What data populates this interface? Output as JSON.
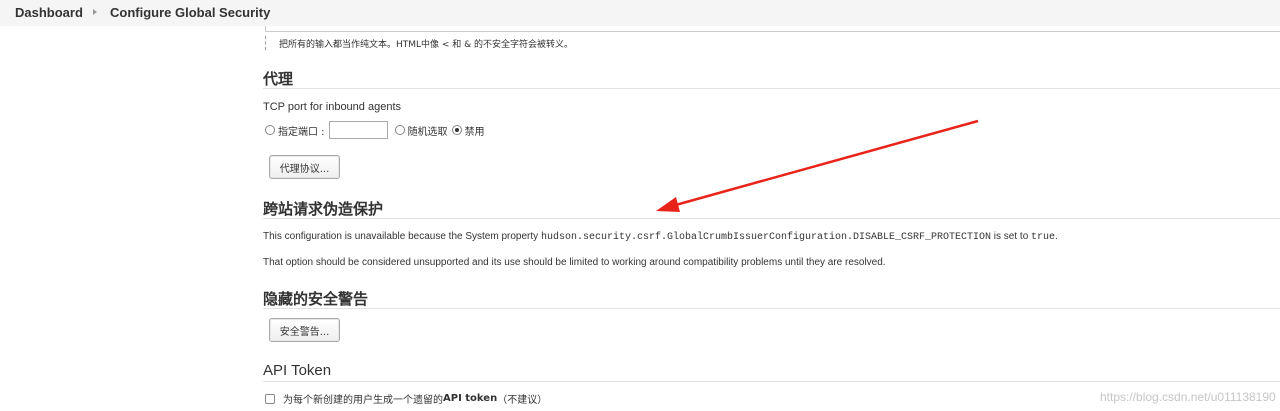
{
  "breadcrumb": {
    "items": [
      "Dashboard",
      "Configure Global Security"
    ]
  },
  "markup_help": "把所有的输入都当作纯文本。HTML中像 < 和 & 的不安全字符会被转义。",
  "proxy": {
    "title": "代理",
    "tcp_label": "TCP port for inbound agents",
    "options": {
      "fixed": "指定端口 :",
      "random": "随机选取",
      "disable": "禁用"
    },
    "selected": "disable",
    "port_value": "",
    "protocols_button": "代理协议..."
  },
  "csrf": {
    "title": "跨站请求伪造保护",
    "line1_prefix": "This configuration is unavailable because the System property ",
    "line1_property": "hudson.security.csrf.GlobalCrumbIssuerConfiguration.DISABLE_CSRF_PROTECTION",
    "line1_mid": " is set to ",
    "line1_value": "true",
    "line1_suffix": ".",
    "line2": "That option should be considered unsupported and its use should be limited to working around compatibility problems until they are resolved."
  },
  "hidden_warnings": {
    "title": "隐藏的安全警告",
    "button": "安全警告..."
  },
  "api_token": {
    "title": "API Token",
    "checkbox_pre": "为每个新创建的用户生成一个遗留的 ",
    "checkbox_bold": "API token",
    "checkbox_post": " （不建议）",
    "checked": false
  },
  "watermark": "https://blog.csdn.net/u011138190",
  "colors": {
    "arrow": "#e8231a",
    "breadcrumb_bg": "#f5f5f5"
  }
}
